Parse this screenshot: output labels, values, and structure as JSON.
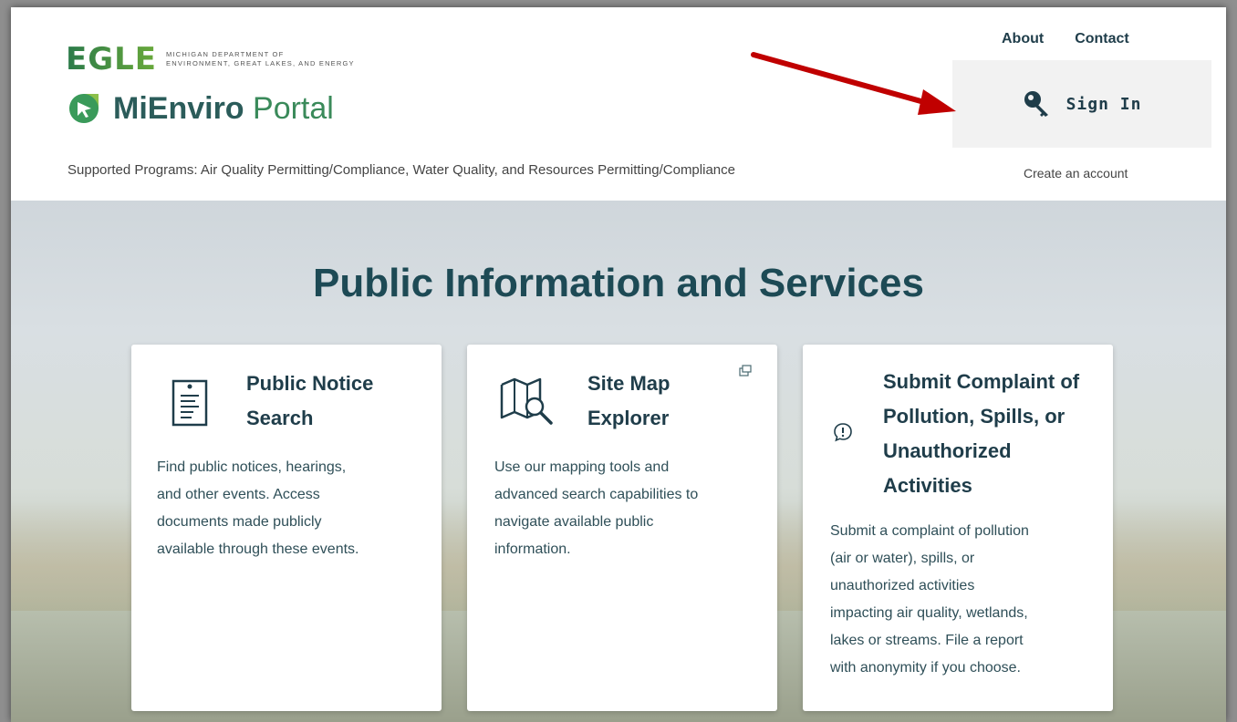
{
  "header": {
    "egle_wordmark": "EGLE",
    "egle_subtitle_line1": "MICHIGAN DEPARTMENT OF",
    "egle_subtitle_line2": "ENVIRONMENT, GREAT LAKES, AND ENERGY",
    "portal_title_bold": "MiEnviro",
    "portal_title_light": " Portal",
    "supported_programs": "Supported Programs: Air Quality Permitting/Compliance, Water Quality, and Resources Permitting/Compliance",
    "nav": {
      "about": "About",
      "contact": "Contact"
    },
    "sign_in_label": "Sign In",
    "create_account": "Create an account"
  },
  "hero": {
    "title": "Public Information and Services"
  },
  "cards": [
    {
      "icon": "document-icon",
      "title_line1": "Public Notice",
      "title_line2": "Search",
      "desc_lines": [
        "Find public notices, hearings,",
        "and other events. Access",
        "documents made publicly",
        "available through these events."
      ]
    },
    {
      "icon": "map-search-icon",
      "title_line1": "Site Map",
      "title_line2": "Explorer",
      "external": true,
      "desc_lines": [
        "Use our mapping tools and",
        "advanced search capabilities to",
        "navigate available public",
        "information."
      ]
    },
    {
      "icon": "alert-bubble-icon",
      "title_lines": [
        "Submit Complaint of",
        "Pollution, Spills, or",
        "Unauthorized",
        "Activities"
      ],
      "desc_lines": [
        "Submit a complaint of pollution",
        "(air or water), spills, or",
        "unauthorized activities",
        "impacting air quality, wetlands,",
        "lakes or streams. File a report",
        "with anonymity if you choose."
      ]
    }
  ],
  "colors": {
    "brand_dark": "#1f3d4a",
    "brand_green": "#3a8a5a",
    "annotation_arrow": "#c00000"
  }
}
